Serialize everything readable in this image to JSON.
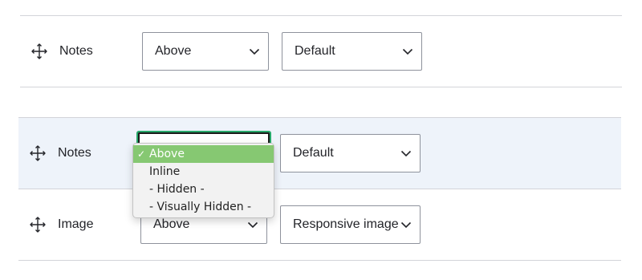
{
  "rows": [
    {
      "label": "Notes",
      "label_select": "Above",
      "format_select": "Default"
    },
    {
      "label": "Notes",
      "label_select": "",
      "format_select": "Default"
    },
    {
      "label": "Image",
      "label_select": "Above",
      "format_select": "Responsive image"
    }
  ],
  "dropdown": {
    "check": "✓",
    "options": [
      "Above",
      "Inline",
      "- Hidden -",
      "- Visually Hidden -"
    ],
    "selected": "Above"
  },
  "colors": {
    "focus_border": "#26a769",
    "selected_option": "#86c872",
    "highlight_row": "#eef3fa"
  },
  "icons": {
    "drag_handle": "move-icon",
    "select_arrow": "chevron-down-icon"
  }
}
